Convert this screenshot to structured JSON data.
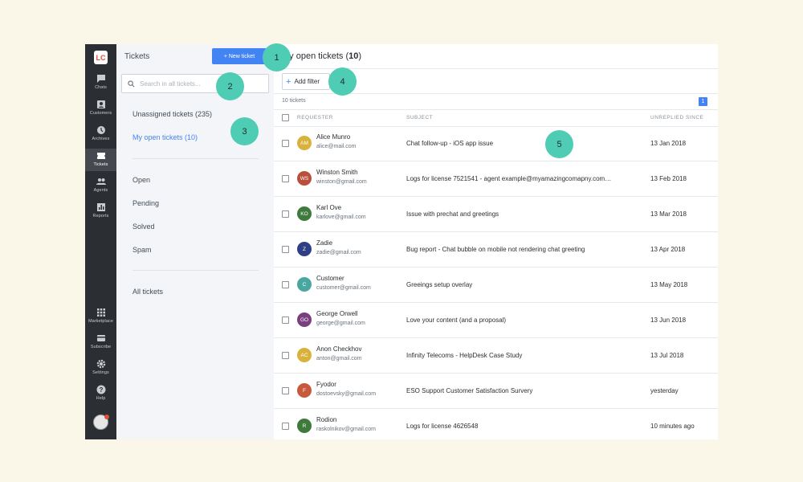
{
  "rail": {
    "logo": "LC",
    "items": [
      {
        "label": "Chats",
        "icon": "chat-icon"
      },
      {
        "label": "Customers",
        "icon": "customers-icon"
      },
      {
        "label": "Archives",
        "icon": "archives-icon"
      },
      {
        "label": "Tickets",
        "icon": "tickets-icon"
      },
      {
        "label": "Agents",
        "icon": "agents-icon"
      },
      {
        "label": "Reports",
        "icon": "reports-icon"
      },
      {
        "label": "Marketplace",
        "icon": "marketplace-icon"
      },
      {
        "label": "Subscribe",
        "icon": "subscribe-icon"
      },
      {
        "label": "Settings",
        "icon": "settings-icon"
      },
      {
        "label": "Help",
        "icon": "help-icon"
      }
    ],
    "active": "Tickets"
  },
  "sidebar": {
    "title": "Tickets",
    "new_ticket": "+ New ticket",
    "search_placeholder": "Search in all tickets...",
    "views": [
      "Unassigned tickets (235)",
      "My open tickets (10)"
    ],
    "statuses": [
      "Open",
      "Pending",
      "Solved",
      "Spam"
    ],
    "all": "All tickets"
  },
  "main": {
    "title_prefix": "My open tickets (",
    "title_count": "10",
    "title_suffix": ")",
    "add_filter": "Add filter",
    "ticket_count": "10 tickets",
    "page": "1",
    "columns": {
      "requester": "REQUESTER",
      "subject": "SUBJECT",
      "since": "UNREPLIED SINCE"
    },
    "rows": [
      {
        "initials": "AM",
        "color": "#d9b23c",
        "name": "Alice Munro",
        "email": "alice@mail.com",
        "subject": "Chat follow-up - iOS app issue",
        "since": "13 Jan 2018"
      },
      {
        "initials": "WS",
        "color": "#b9503c",
        "name": "Winston Smith",
        "email": "winston@gmail.com",
        "subject": "Logs for license 7521541 - agent example@myamazingcomapny.com…",
        "since": "13 Feb 2018"
      },
      {
        "initials": "KO",
        "color": "#3f7a3c",
        "name": "Karl Ove",
        "email": "karlove@gmail.com",
        "subject": "Issue with prechat and greetings",
        "since": "13 Mar 2018"
      },
      {
        "initials": "Z",
        "color": "#2e3f86",
        "name": "Zadie",
        "email": "zadie@gmail.com",
        "subject": "Bug report - Chat bubble on mobile not rendering chat greeting",
        "since": "13 Apr 2018"
      },
      {
        "initials": "C",
        "color": "#4aa6a0",
        "name": "Customer",
        "email": "customer@gmail.com",
        "subject": "Greeings setup overlay",
        "since": "13 May 2018"
      },
      {
        "initials": "GO",
        "color": "#7a3f7e",
        "name": "George Orwell",
        "email": "george@gmail.com",
        "subject": "Love your content (and a proposal)",
        "since": "13 Jun 2018"
      },
      {
        "initials": "AC",
        "color": "#d9b23c",
        "name": "Anon Checkhov",
        "email": "anton@gmail.com",
        "subject": "Infinity Telecoms - HelpDesk Case Study",
        "since": "13 Jul 2018"
      },
      {
        "initials": "F",
        "color": "#c65a3a",
        "name": "Fyodor",
        "email": "dostoevsky@gmail.com",
        "subject": "ESO Support Customer Satisfaction Survery",
        "since": "yesterday"
      },
      {
        "initials": "R",
        "color": "#3f7a3c",
        "name": "Rodion",
        "email": "raskolnikov@gmail.com",
        "subject": "Logs for license 4626548",
        "since": "10 minutes ago"
      }
    ]
  },
  "callouts": [
    "1",
    "2",
    "3",
    "4",
    "5"
  ],
  "colors": {
    "accent": "#4384f5",
    "callout": "#4ecdb4",
    "rail": "#2b2e33",
    "background": "#fbf7e8"
  }
}
